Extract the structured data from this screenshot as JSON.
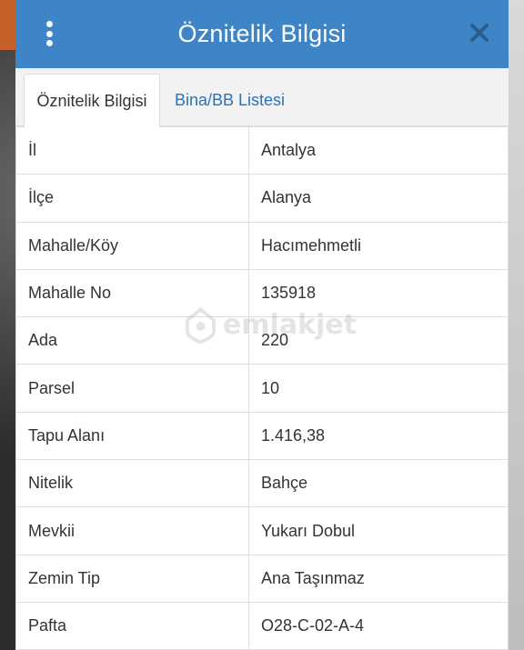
{
  "header": {
    "title": "Öznitelik Bilgisi",
    "menu_icon": "kebab-menu-icon",
    "close_icon": "close-icon",
    "color": "#3d85c6"
  },
  "tabs": [
    {
      "label": "Öznitelik Bilgisi",
      "active": true
    },
    {
      "label": "Bina/BB Listesi",
      "active": false
    }
  ],
  "attributes": [
    {
      "key": "İl",
      "value": "Antalya"
    },
    {
      "key": "İlçe",
      "value": "Alanya"
    },
    {
      "key": "Mahalle/Köy",
      "value": "Hacımehmetli"
    },
    {
      "key": "Mahalle No",
      "value": "135918"
    },
    {
      "key": "Ada",
      "value": "220"
    },
    {
      "key": "Parsel",
      "value": "10"
    },
    {
      "key": "Tapu Alanı",
      "value": "1.416,38"
    },
    {
      "key": "Nitelik",
      "value": "Bahçe"
    },
    {
      "key": "Mevkii",
      "value": "Yukarı Dobul"
    },
    {
      "key": "Zemin Tip",
      "value": "Ana Taşınmaz"
    },
    {
      "key": "Pafta",
      "value": "O28-C-02-A-4"
    }
  ],
  "watermark": {
    "text": "emlakjet"
  }
}
